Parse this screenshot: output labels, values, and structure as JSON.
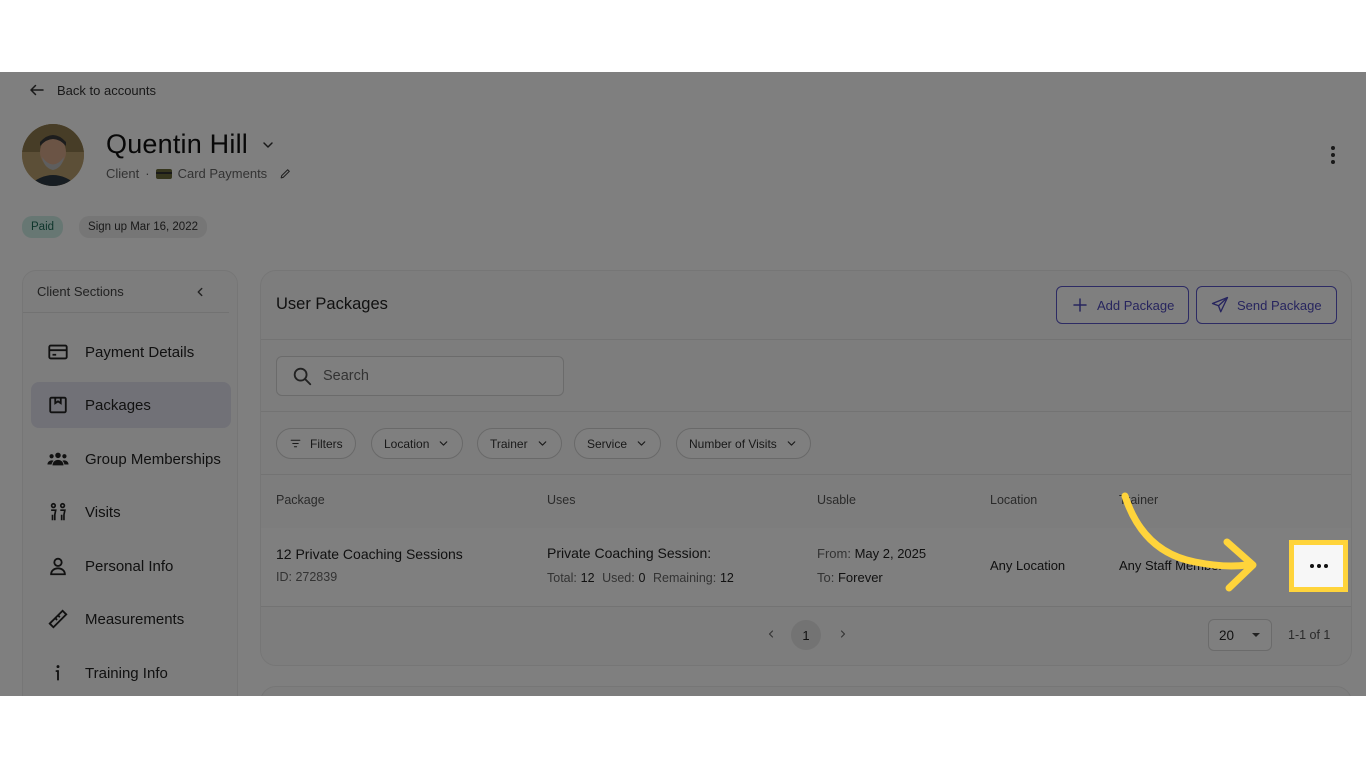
{
  "nav": {
    "back_label": "Back to accounts"
  },
  "profile": {
    "name": "Quentin Hill",
    "role": "Client",
    "separator": "·",
    "payment": "Card Payments"
  },
  "badges": {
    "paid": "Paid",
    "signup": "Sign up Mar 16, 2022"
  },
  "sidebar": {
    "title": "Client Sections",
    "items": [
      {
        "label": "Payment Details",
        "icon": "credit-card-icon"
      },
      {
        "label": "Packages",
        "icon": "package-icon",
        "active": true
      },
      {
        "label": "Group Memberships",
        "icon": "group-icon"
      },
      {
        "label": "Visits",
        "icon": "visits-icon"
      },
      {
        "label": "Personal Info",
        "icon": "person-icon"
      },
      {
        "label": "Measurements",
        "icon": "ruler-icon"
      },
      {
        "label": "Training Info",
        "icon": "info-icon"
      }
    ]
  },
  "packages": {
    "title": "User Packages",
    "add_button": "Add Package",
    "send_button": "Send Package",
    "search_placeholder": "Search",
    "filters": {
      "filters": "Filters",
      "location": "Location",
      "trainer": "Trainer",
      "service": "Service",
      "visits": "Number of Visits"
    },
    "columns": {
      "package": "Package",
      "uses": "Uses",
      "usable": "Usable",
      "location": "Location",
      "trainer": "Trainer"
    },
    "rows": [
      {
        "name": "12 Private Coaching Sessions",
        "id": "ID: 272839",
        "service": "Private Coaching Session:",
        "total_label": "Total:",
        "total": "12",
        "used_label": "Used:",
        "used": "0",
        "remaining_label": "Remaining:",
        "remaining": "12",
        "from_label": "From:",
        "from": "May 2, 2025",
        "to_label": "To:",
        "to": "Forever",
        "location": "Any Location",
        "trainer": "Any Staff Member"
      }
    ],
    "pagination": {
      "current": "1",
      "page_size": "20",
      "range": "1-1 of 1"
    }
  },
  "colors": {
    "accent": "#5a56c8",
    "highlight": "#ffd43b",
    "paid_badge": "#cfeee6",
    "overlay": "rgba(0,0,0,0.5)"
  }
}
